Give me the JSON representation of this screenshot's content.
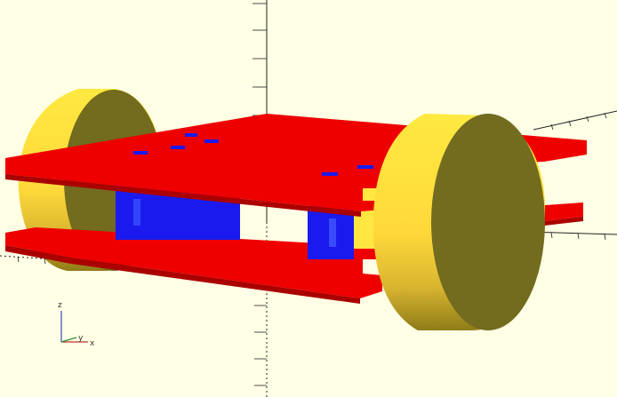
{
  "viewport": {
    "background": "#ffffe5",
    "model_colors": {
      "chassis_red": "#ee0000",
      "chassis_dark": "#aa0000",
      "motor_blue": "#1a1aee",
      "wheel_yellow": "#ffe640",
      "wheel_face": "#736b1e"
    },
    "axes": {
      "z_label": "z",
      "y_label": "y",
      "x_label": "x",
      "colors": {
        "x": "#c03030",
        "y": "#2a8a2a",
        "z": "#3050c0"
      }
    }
  }
}
